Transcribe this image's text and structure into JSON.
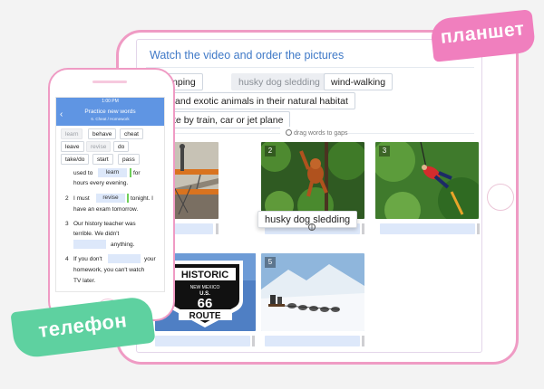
{
  "tablet": {
    "sticker": "планшет",
    "title": "Watch the video and order the pictures",
    "words": {
      "w1": "bungee jumping",
      "w2": "husky dog sledding",
      "w3": "wind-walking",
      "w4": "observing rare and exotic animals in their natural habitat",
      "w5": "travelling a historic route by train, car or jet plane"
    },
    "hint": "drag words to gaps",
    "dragging_chip": "husky dog sledding",
    "photo_numbers": {
      "p2": "2",
      "p3": "3",
      "p5": "5"
    },
    "sign": {
      "top": "HISTORIC",
      "state": "NEW MEXICO",
      "us": "U.S.",
      "number": "66",
      "bottom": "ROUTE"
    }
  },
  "phone": {
    "sticker": "телефон",
    "status_time": "1:00 PM",
    "header_title": "Practice new words",
    "header_sub": "6. Cheat / Homework",
    "back_icon": "chevron-left-icon",
    "chips": {
      "c1": "learn",
      "c2": "behave",
      "c3": "cheat",
      "c4": "leave",
      "c5": "revise",
      "c6": "do",
      "c7": "take/do",
      "c8": "start",
      "c9": "pass"
    },
    "s1": {
      "a": "used to",
      "gap": "learn",
      "b": "for",
      "c": "hours every evening."
    },
    "s2": {
      "num": "2",
      "a": "I must",
      "gap": "revise",
      "b": "tonight. I",
      "c": "have an exam tomorrow."
    },
    "s3": {
      "num": "3",
      "a": "Our history teacher was",
      "b": "terrible. We didn't",
      "c": "anything."
    },
    "s4": {
      "num": "4",
      "a": "If you don't",
      "b": "your",
      "c": "homework, you can't watch",
      "d": "TV later."
    }
  },
  "colors": {
    "accent_blue": "#5f95e3",
    "device_pink": "#ef9bc4",
    "tag_pink": "#f07fbe",
    "tag_green": "#5ed1a0",
    "gap_blue": "#dde8fa"
  }
}
